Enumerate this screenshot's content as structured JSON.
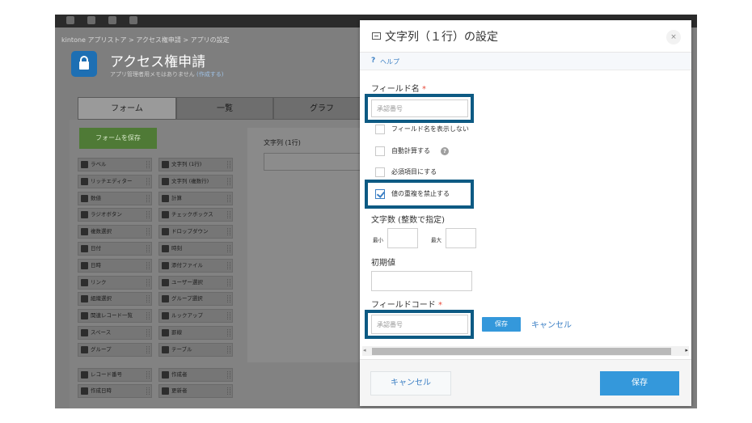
{
  "breadcrumb": "kintone アプリストア  >  アクセス権申請  >  アプリの設定",
  "app": {
    "title": "アクセス権申請",
    "memo_text": "アプリ管理者用メモはありません",
    "memo_link": "(作成する)"
  },
  "tabs": [
    {
      "label": "フォーム"
    },
    {
      "label": "一覧"
    },
    {
      "label": "グラフ"
    }
  ],
  "form_save_label": "フォームを保存",
  "palette": [
    {
      "label": "ラベル",
      "icon": "tag-icon"
    },
    {
      "label": "文字列 (1行)",
      "icon": "text-single-icon"
    },
    {
      "label": "リッチエディター",
      "icon": "rich-editor-icon"
    },
    {
      "label": "文字列 (複数行)",
      "icon": "text-multi-icon"
    },
    {
      "label": "数値",
      "icon": "number-icon"
    },
    {
      "label": "計算",
      "icon": "calc-icon"
    },
    {
      "label": "ラジオボタン",
      "icon": "radio-icon"
    },
    {
      "label": "チェックボックス",
      "icon": "checkbox-icon"
    },
    {
      "label": "複数選択",
      "icon": "multi-select-icon"
    },
    {
      "label": "ドロップダウン",
      "icon": "dropdown-icon"
    },
    {
      "label": "日付",
      "icon": "date-icon"
    },
    {
      "label": "時刻",
      "icon": "time-icon"
    },
    {
      "label": "日時",
      "icon": "datetime-icon"
    },
    {
      "label": "添付ファイル",
      "icon": "attachment-icon"
    },
    {
      "label": "リンク",
      "icon": "link-icon"
    },
    {
      "label": "ユーザー選択",
      "icon": "user-select-icon"
    },
    {
      "label": "組織選択",
      "icon": "org-select-icon"
    },
    {
      "label": "グループ選択",
      "icon": "group-select-icon"
    },
    {
      "label": "関連レコード一覧",
      "icon": "related-records-icon"
    },
    {
      "label": "ルックアップ",
      "icon": "lookup-icon"
    },
    {
      "label": "スペース",
      "icon": "space-icon"
    },
    {
      "label": "罫線",
      "icon": "border-icon"
    },
    {
      "label": "グループ",
      "icon": "group-icon"
    },
    {
      "label": "テーブル",
      "icon": "table-icon"
    },
    {
      "label": "レコード番号",
      "icon": "record-number-icon"
    },
    {
      "label": "作成者",
      "icon": "creator-icon"
    },
    {
      "label": "作成日時",
      "icon": "created-date-icon"
    },
    {
      "label": "更新者",
      "icon": "updater-icon"
    }
  ],
  "canvas_field_label": "文字列 (1行)",
  "dialog": {
    "title": "文字列（１行）の設定",
    "close": "×",
    "help_mark": "?",
    "help": "ヘルプ",
    "field_name_label": "フィールド名",
    "required_mark": "*",
    "field_name_value": "承認番号",
    "hide_name_label": "フィールド名を表示しない",
    "auto_calc_label": "自動計算する",
    "auto_calc_help": "?",
    "required_label": "必須項目にする",
    "unique_label": "値の重複を禁止する",
    "unique_checked": true,
    "char_count_label": "文字数 (整数で指定)",
    "min_label": "最小",
    "max_label": "最大",
    "default_label": "初期値",
    "field_code_label": "フィールドコード",
    "field_code_value": "承認番号",
    "inline_save": "保存",
    "inline_cancel": "キャンセル",
    "footer_cancel": "キャンセル",
    "footer_save": "保存",
    "scroll_left": "◂",
    "scroll_right": "▸"
  },
  "colors": {
    "highlight": "#0d5a83",
    "accent": "#3498db",
    "link": "#3b7fc4",
    "required": "#e74c3c"
  }
}
